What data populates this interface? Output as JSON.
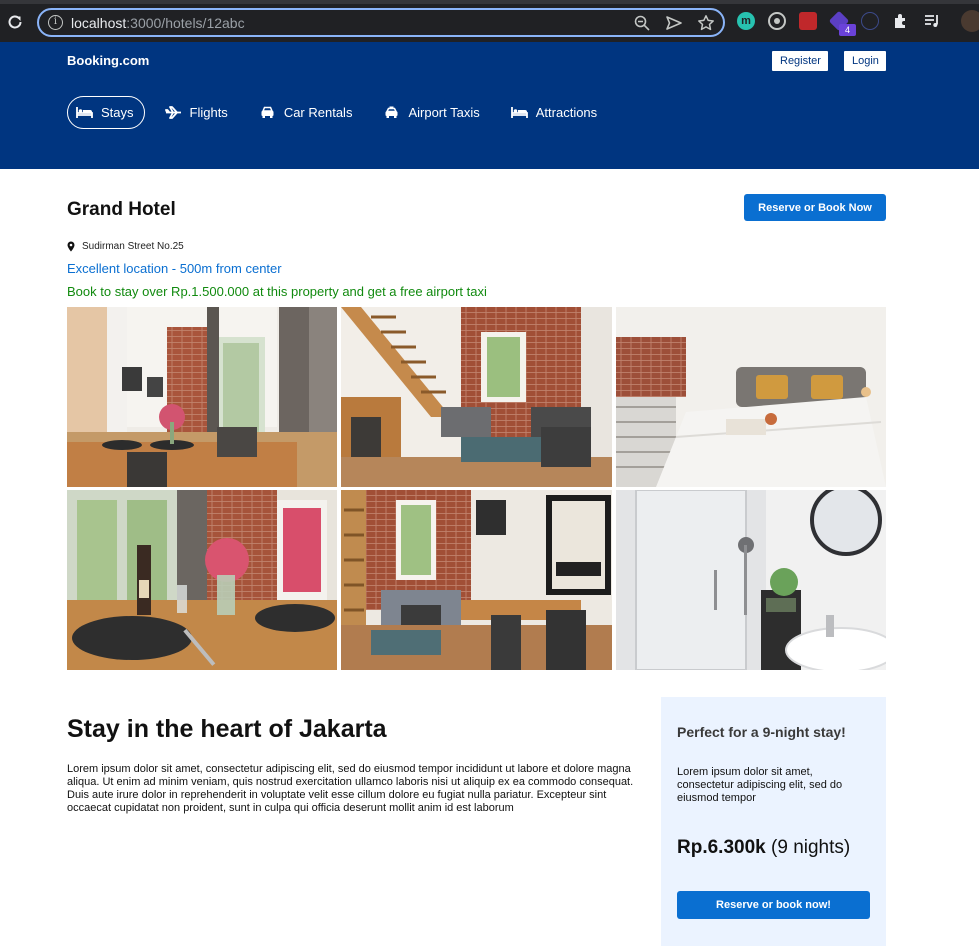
{
  "browser": {
    "url_host": "localhost",
    "url_path": ":3000/hotels/12abc",
    "extension_badge": "4",
    "extension_m_label": "m"
  },
  "header": {
    "brand": "Booking.com",
    "register_label": "Register",
    "login_label": "Login",
    "nav": [
      {
        "label": "Stays",
        "icon": "bed-icon",
        "active": true
      },
      {
        "label": "Flights",
        "icon": "plane-icon",
        "active": false
      },
      {
        "label": "Car Rentals",
        "icon": "car-icon",
        "active": false
      },
      {
        "label": "Airport Taxis",
        "icon": "taxi-icon",
        "active": false
      },
      {
        "label": "Attractions",
        "icon": "bed-icon",
        "active": false
      }
    ]
  },
  "hotel": {
    "name": "Grand Hotel",
    "reserve_label": "Reserve or Book Now",
    "address": "Sudirman Street No.25",
    "location_note": "Excellent location - 500m from center",
    "promo_note": "Book to stay over Rp.1.500.000 at this property and get a free airport taxi",
    "photos": [
      "living-dining-photo",
      "loft-stairs-photo",
      "bedroom-photo",
      "dining-table-photo",
      "lounge-poster-photo",
      "bathroom-photo"
    ]
  },
  "details": {
    "title": "Stay in the heart of Jakarta",
    "description": "Lorem ipsum dolor sit amet, consectetur adipiscing elit, sed do eiusmod tempor incididunt ut labore et dolore magna aliqua. Ut enim ad minim veniam, quis nostrud exercitation ullamco laboris nisi ut aliquip ex ea commodo consequat. Duis aute irure dolor in reprehenderit in voluptate velit esse cillum dolore eu fugiat nulla pariatur. Excepteur sint occaecat cupidatat non proident, sunt in culpa qui officia deserunt mollit anim id est laborum"
  },
  "price_card": {
    "title": "Perfect for a 9-night stay!",
    "description": "Lorem ipsum dolor sit amet, consectetur adipiscing elit, sed do eiusmod tempor",
    "price": "Rp.6.300k",
    "nights": "(9 nights)",
    "button_label": "Reserve or book now!"
  },
  "colors": {
    "header_bg": "#003580",
    "accent_blue": "#0a6fd1",
    "promo_green": "#118a0f",
    "card_bg": "#ebf3ff"
  }
}
